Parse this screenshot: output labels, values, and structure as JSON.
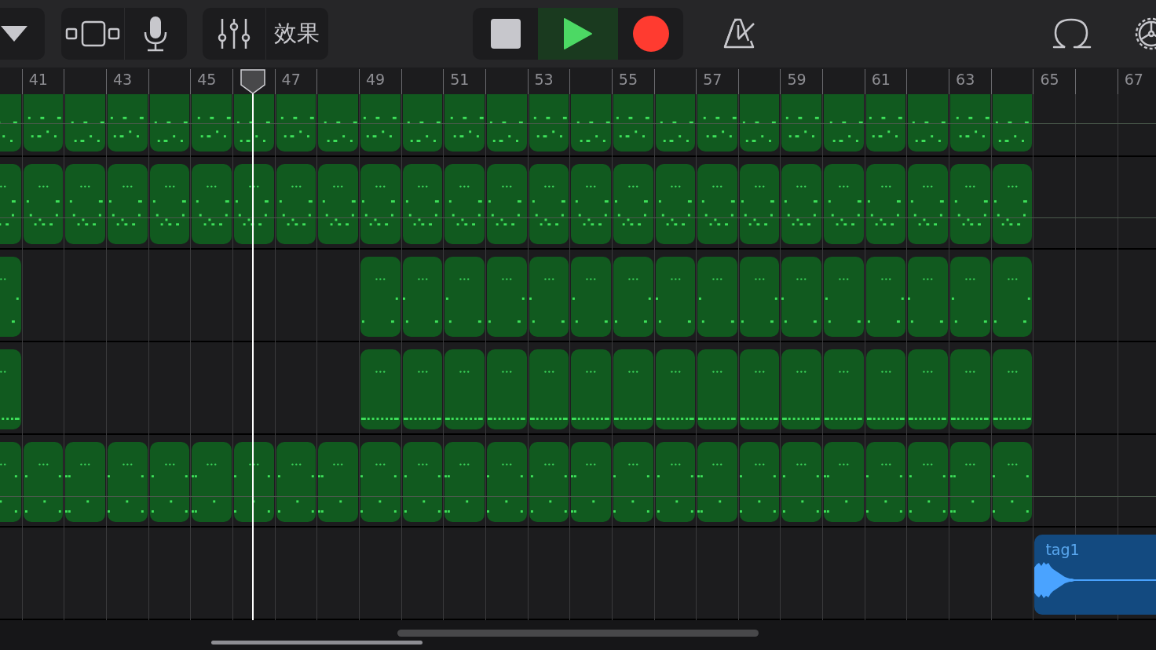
{
  "toolbar": {
    "effects_label": "效果",
    "transport": [
      {
        "kind": "stop",
        "on": false
      },
      {
        "kind": "play",
        "on": true
      },
      {
        "kind": "record",
        "on": false
      }
    ]
  },
  "ruler": {
    "labels": [
      "41",
      "43",
      "45",
      "47",
      "49",
      "51",
      "53",
      "55",
      "57",
      "59",
      "61",
      "63",
      "65",
      "67"
    ]
  },
  "playhead": {
    "level": 0.219
  },
  "tracks": [
    {
      "kind": "lead",
      "slots": [
        {
          "kind": "midi"
        },
        {
          "kind": "midi"
        },
        {
          "kind": "midi"
        },
        {
          "kind": "midi"
        },
        {
          "kind": "midi"
        },
        {
          "kind": "midi"
        },
        {
          "kind": "midi"
        },
        {
          "kind": "midi"
        },
        {
          "kind": "midi"
        },
        {
          "kind": "midi"
        },
        {
          "kind": "midi"
        },
        {
          "kind": "midi"
        },
        {
          "kind": "midi"
        },
        {
          "kind": "midi"
        },
        {
          "kind": "midi"
        },
        {
          "kind": "midi"
        },
        {
          "kind": "midi"
        },
        {
          "kind": "midi"
        },
        {
          "kind": "midi"
        },
        {
          "kind": "midi"
        },
        {
          "kind": "midi"
        },
        {
          "kind": "midi"
        },
        {
          "kind": "midi"
        },
        {
          "kind": "midi"
        },
        {
          "kind": "midi"
        }
      ]
    },
    {
      "kind": "chords",
      "slots": [
        {
          "kind": "midi"
        },
        {
          "kind": "midi"
        },
        {
          "kind": "midi"
        },
        {
          "kind": "midi"
        },
        {
          "kind": "midi"
        },
        {
          "kind": "midi"
        },
        {
          "kind": "midi"
        },
        {
          "kind": "midi"
        },
        {
          "kind": "midi"
        },
        {
          "kind": "midi"
        },
        {
          "kind": "midi"
        },
        {
          "kind": "midi"
        },
        {
          "kind": "midi"
        },
        {
          "kind": "midi"
        },
        {
          "kind": "midi"
        },
        {
          "kind": "midi"
        },
        {
          "kind": "midi"
        },
        {
          "kind": "midi"
        },
        {
          "kind": "midi"
        },
        {
          "kind": "midi"
        },
        {
          "kind": "midi"
        },
        {
          "kind": "midi"
        },
        {
          "kind": "midi"
        },
        {
          "kind": "midi"
        },
        {
          "kind": "midi"
        }
      ]
    },
    {
      "kind": "keys",
      "slots": [
        {
          "kind": "midi"
        },
        {
          "kind": "none"
        },
        {
          "kind": "none"
        },
        {
          "kind": "none"
        },
        {
          "kind": "none"
        },
        {
          "kind": "none"
        },
        {
          "kind": "none"
        },
        {
          "kind": "none"
        },
        {
          "kind": "none"
        },
        {
          "kind": "midi"
        },
        {
          "kind": "midi"
        },
        {
          "kind": "midi"
        },
        {
          "kind": "midi"
        },
        {
          "kind": "midi"
        },
        {
          "kind": "midi"
        },
        {
          "kind": "midi"
        },
        {
          "kind": "midi"
        },
        {
          "kind": "midi"
        },
        {
          "kind": "midi"
        },
        {
          "kind": "midi"
        },
        {
          "kind": "midi"
        },
        {
          "kind": "midi"
        },
        {
          "kind": "midi"
        },
        {
          "kind": "midi"
        },
        {
          "kind": "midi"
        }
      ]
    },
    {
      "kind": "hats",
      "slots": [
        {
          "kind": "midi"
        },
        {
          "kind": "none"
        },
        {
          "kind": "none"
        },
        {
          "kind": "none"
        },
        {
          "kind": "none"
        },
        {
          "kind": "none"
        },
        {
          "kind": "none"
        },
        {
          "kind": "none"
        },
        {
          "kind": "none"
        },
        {
          "kind": "midi"
        },
        {
          "kind": "midi"
        },
        {
          "kind": "midi"
        },
        {
          "kind": "midi"
        },
        {
          "kind": "midi"
        },
        {
          "kind": "midi"
        },
        {
          "kind": "midi"
        },
        {
          "kind": "midi"
        },
        {
          "kind": "midi"
        },
        {
          "kind": "midi"
        },
        {
          "kind": "midi"
        },
        {
          "kind": "midi"
        },
        {
          "kind": "midi"
        },
        {
          "kind": "midi"
        },
        {
          "kind": "midi"
        },
        {
          "kind": "midi"
        }
      ]
    },
    {
      "kind": "bass",
      "slots": [
        {
          "kind": "midi"
        },
        {
          "kind": "midi"
        },
        {
          "kind": "midi"
        },
        {
          "kind": "midi"
        },
        {
          "kind": "midi"
        },
        {
          "kind": "midi"
        },
        {
          "kind": "midi"
        },
        {
          "kind": "midi"
        },
        {
          "kind": "midi"
        },
        {
          "kind": "midi"
        },
        {
          "kind": "midi"
        },
        {
          "kind": "midi"
        },
        {
          "kind": "midi"
        },
        {
          "kind": "midi"
        },
        {
          "kind": "midi"
        },
        {
          "kind": "midi"
        },
        {
          "kind": "midi"
        },
        {
          "kind": "midi"
        },
        {
          "kind": "midi"
        },
        {
          "kind": "midi"
        },
        {
          "kind": "midi"
        },
        {
          "kind": "midi"
        },
        {
          "kind": "midi"
        },
        {
          "kind": "midi"
        },
        {
          "kind": "midi"
        }
      ]
    },
    {
      "kind": "audio",
      "slots": [
        {
          "kind": "none"
        },
        {
          "kind": "none"
        },
        {
          "kind": "none"
        },
        {
          "kind": "none"
        },
        {
          "kind": "none"
        },
        {
          "kind": "none"
        },
        {
          "kind": "none"
        },
        {
          "kind": "none"
        },
        {
          "kind": "none"
        },
        {
          "kind": "none"
        },
        {
          "kind": "none"
        },
        {
          "kind": "none"
        },
        {
          "kind": "none"
        },
        {
          "kind": "none"
        },
        {
          "kind": "none"
        },
        {
          "kind": "none"
        },
        {
          "kind": "none"
        },
        {
          "kind": "none"
        },
        {
          "kind": "none"
        },
        {
          "kind": "none"
        },
        {
          "kind": "none"
        },
        {
          "kind": "none"
        },
        {
          "kind": "none"
        },
        {
          "kind": "none"
        },
        {
          "kind": "none"
        },
        {
          "kind": "audio",
          "name": "tag1"
        }
      ]
    }
  ]
}
